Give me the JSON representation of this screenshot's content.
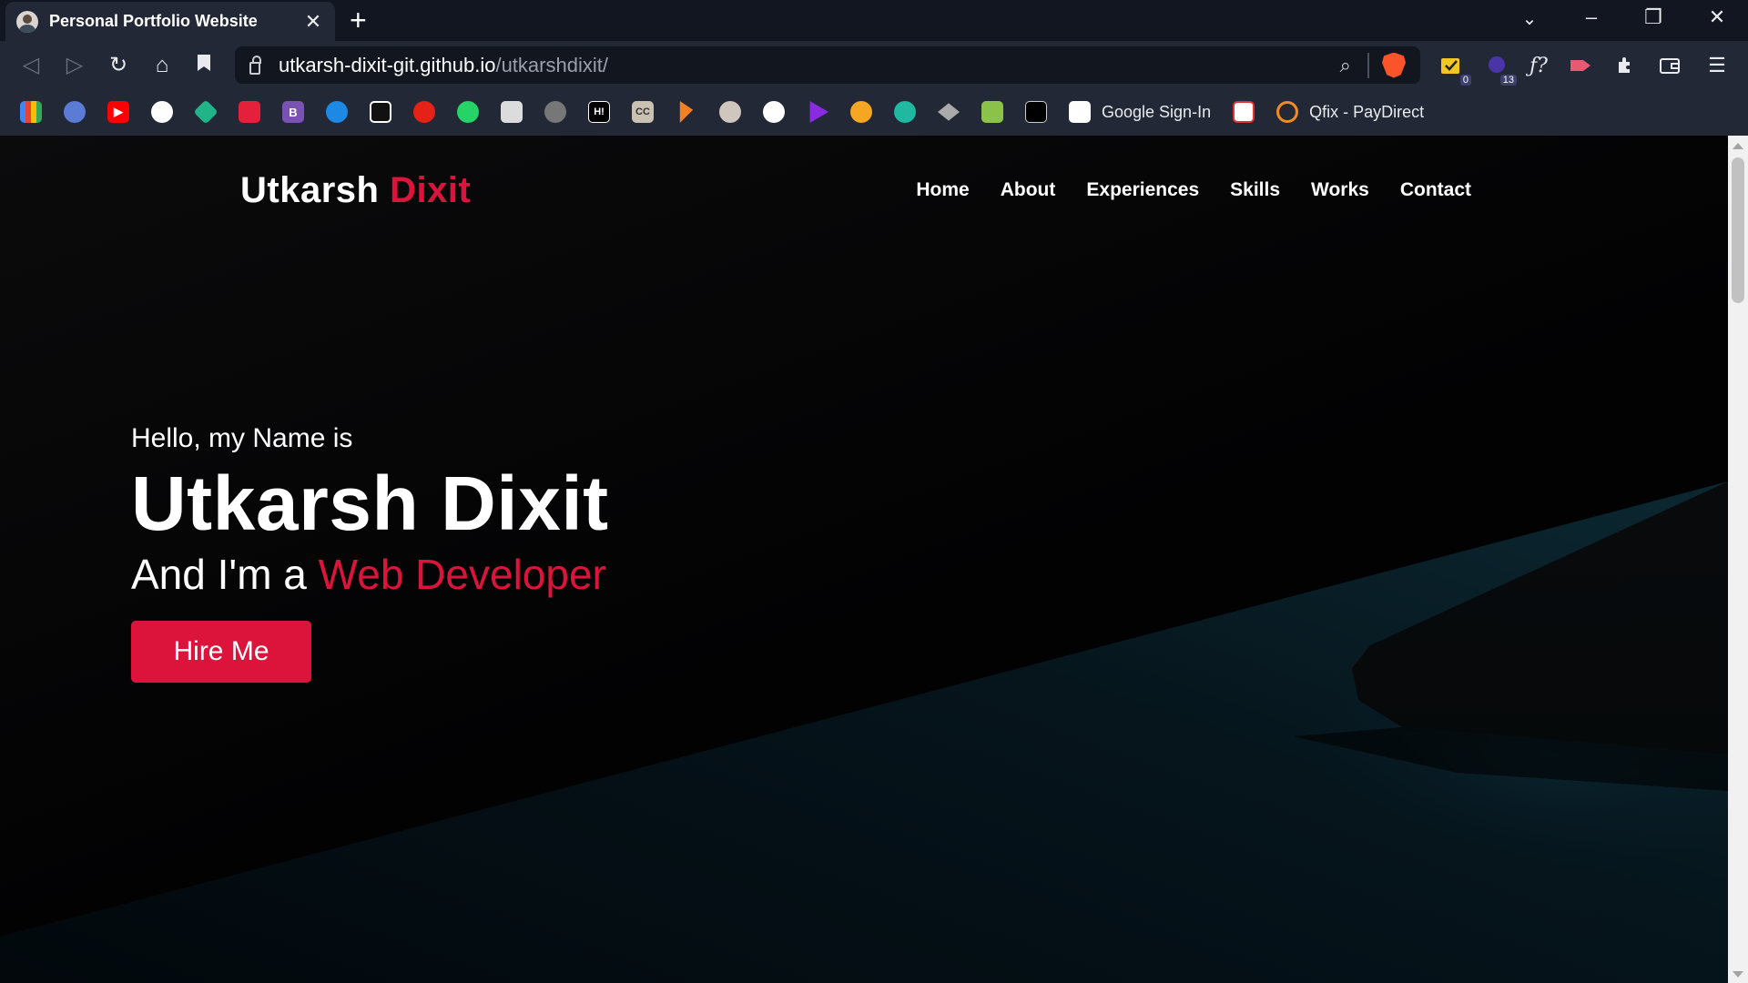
{
  "browser": {
    "tab_title": "Personal Portfolio Website",
    "tab_close": "✕",
    "new_tab": "+",
    "url_host": "utkarsh-dixit-git.github.io",
    "url_path": "/utkarshdixit/",
    "extension_badges": {
      "todo": "0",
      "notifications": "13"
    },
    "bookmarks_text": [
      {
        "label": "Google Sign-In"
      },
      {
        "label": "Qfix - PayDirect"
      }
    ],
    "bookmark_badges": {
      "b": "B",
      "cc": "CC",
      "hi": "H!"
    }
  },
  "site": {
    "logo_first": "Utkarsh",
    "logo_accent": "Dixit",
    "nav": [
      "Home",
      "About",
      "Experiences",
      "Skills",
      "Works",
      "Contact"
    ],
    "hero": {
      "greeting": "Hello, my Name is",
      "name": "Utkarsh Dixit",
      "role_prefix": "And I'm a",
      "role_accent": "Web Developer",
      "cta": "Hire Me"
    },
    "colors": {
      "accent": "#dc143c",
      "background": "#000000"
    }
  }
}
